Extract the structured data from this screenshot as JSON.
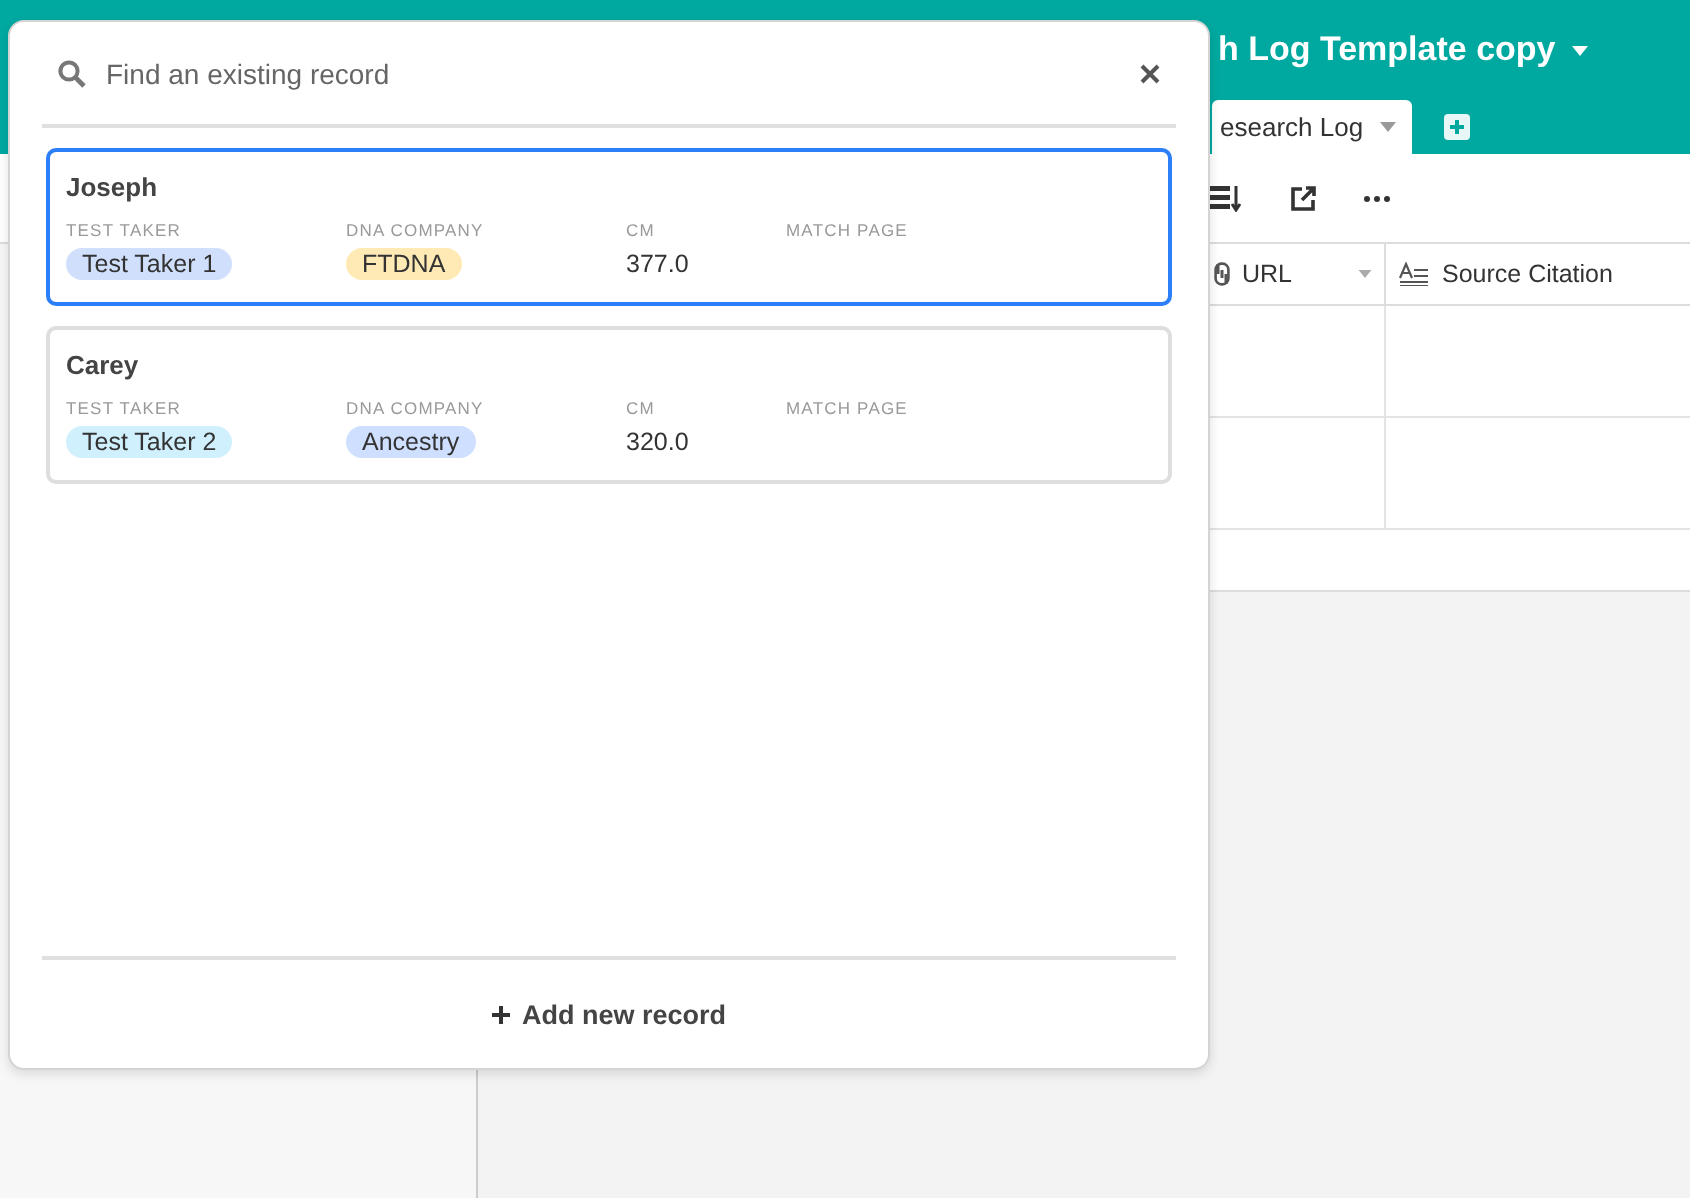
{
  "base": {
    "title": "h Log Template copy",
    "tabs": [
      {
        "label": "esearch Log",
        "selected": true
      }
    ],
    "columns": [
      {
        "label": "URL",
        "kind": "url"
      },
      {
        "label": "Source Citation",
        "kind": "long_text"
      }
    ]
  },
  "record_picker": {
    "search": {
      "placeholder": "Find an existing record"
    },
    "records": [
      {
        "name": "Joseph",
        "selected": true,
        "fields": [
          {
            "label": "TEST TAKER",
            "kind": "tag",
            "value": "Test Taker 1",
            "color": "#d0e0fc"
          },
          {
            "label": "DNA COMPANY",
            "kind": "tag",
            "value": "FTDNA",
            "color": "#ffeab6"
          },
          {
            "label": "CM",
            "kind": "text",
            "value": "377.0"
          },
          {
            "label": "MATCH PAGE",
            "kind": "text"
          }
        ]
      },
      {
        "name": "Carey",
        "selected": false,
        "fields": [
          {
            "label": "TEST TAKER",
            "kind": "tag",
            "value": "Test Taker 2",
            "color": "#d0f0fd"
          },
          {
            "label": "DNA COMPANY",
            "kind": "tag",
            "value": "Ancestry",
            "color": "#cfdfff"
          },
          {
            "label": "CM",
            "kind": "text",
            "value": "320.0"
          },
          {
            "label": "MATCH PAGE",
            "kind": "text"
          }
        ]
      }
    ],
    "add_button": "Add new record"
  }
}
